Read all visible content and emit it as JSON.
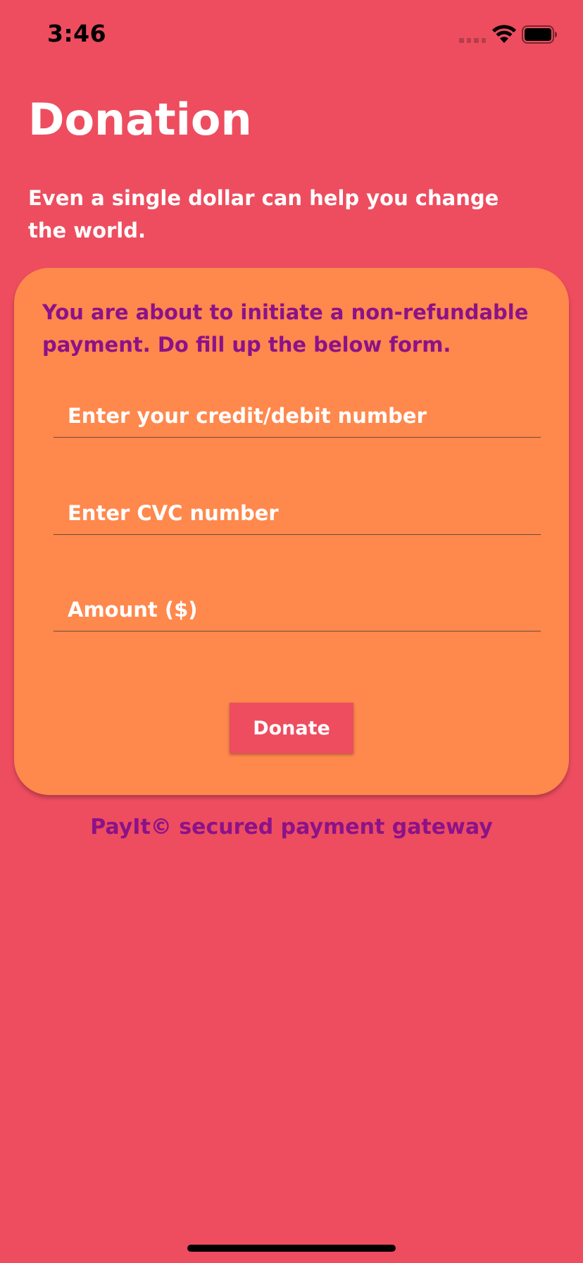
{
  "status_bar": {
    "time": "3:46",
    "icons": [
      "cellular-signal-icon",
      "wifi-icon",
      "battery-icon"
    ]
  },
  "header": {
    "title": "Donation",
    "subtitle": "Even a single dollar can help you change the world."
  },
  "form": {
    "notice": "You are about to initiate a non-refundable payment. Do fill up the below form.",
    "card_number_placeholder": "Enter your credit/debit number",
    "cvc_placeholder": "Enter CVC number",
    "amount_placeholder": "Amount ($)",
    "donate_label": "Donate"
  },
  "footer": {
    "text": "PayIt© secured payment gateway"
  },
  "colors": {
    "background": "#EE4D5F",
    "card": "#FF884D",
    "accent_text": "#8B1289",
    "button": "#EE4D5F"
  }
}
